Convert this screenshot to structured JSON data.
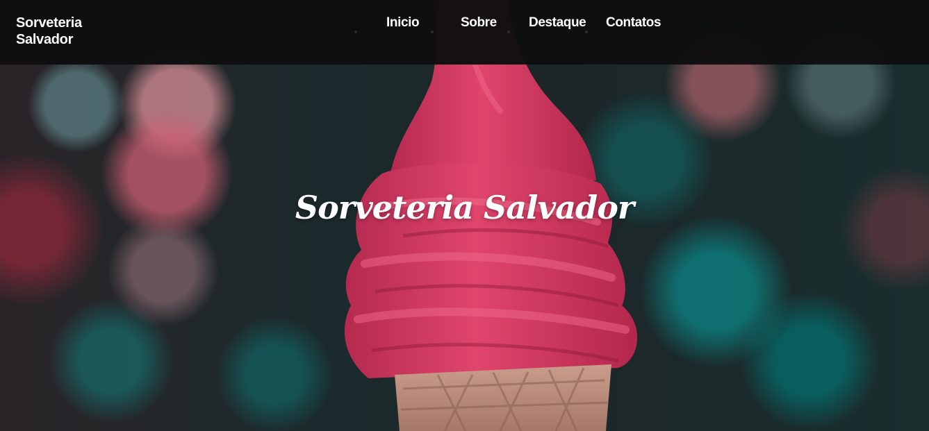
{
  "navbar": {
    "brand": "Sorveteria Salvador",
    "items": [
      {
        "label": "Inicio"
      },
      {
        "label": "Sobre"
      },
      {
        "label": "Destaque"
      },
      {
        "label": "Contatos"
      }
    ]
  },
  "hero": {
    "title": "Sorveteria Salvador"
  },
  "colors": {
    "navbar_bg": "#0e0e0e",
    "text": "#ffffff",
    "ice_cream": "#d63a62"
  },
  "icons": {
    "hero_image": "ice-cream-cone"
  }
}
